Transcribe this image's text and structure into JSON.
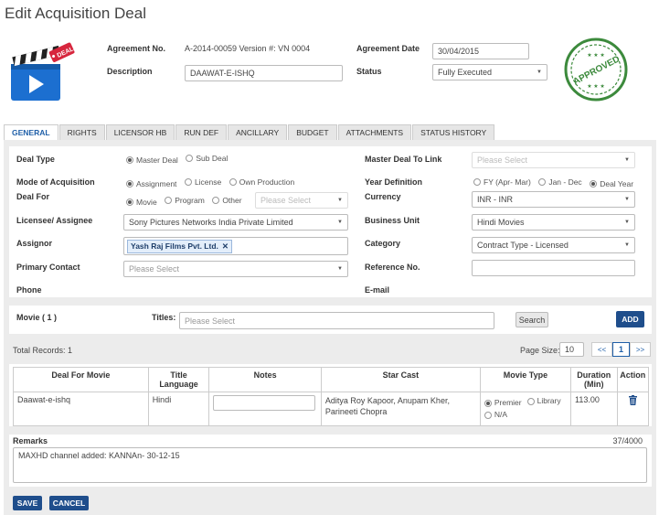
{
  "page_title": "Edit Acquisition Deal",
  "header": {
    "logo_badge": "DEAL",
    "stamp_text": "APPROVED",
    "agreement_no_label": "Agreement No.",
    "agreement_no_value": "A-2014-00059 Version #: VN 0004",
    "agreement_date_label": "Agreement Date",
    "agreement_date_value": "30/04/2015",
    "description_label": "Description",
    "description_value": "DAAWAT-E-ISHQ",
    "status_label": "Status",
    "status_value": "Fully Executed"
  },
  "tabs": [
    "GENERAL",
    "RIGHTS",
    "LICENSOR HB",
    "RUN DEF",
    "ANCILLARY",
    "BUDGET",
    "ATTACHMENTS",
    "STATUS HISTORY"
  ],
  "general": {
    "deal_type_label": "Deal Type",
    "deal_type_options": [
      "Master Deal",
      "Sub Deal"
    ],
    "master_deal_label": "Master Deal To Link",
    "master_deal_placeholder": "Please Select",
    "mode_label": "Mode of Acquisition",
    "mode_options": [
      "Assignment",
      "License",
      "Own Production"
    ],
    "year_def_label": "Year Definition",
    "year_def_options": [
      "FY (Apr- Mar)",
      "Jan - Dec",
      "Deal Year"
    ],
    "deal_for_label": "Deal For",
    "deal_for_options": [
      "Movie",
      "Program",
      "Other"
    ],
    "deal_for_other_placeholder": "Please Select",
    "currency_label": "Currency",
    "currency_value": "INR - INR",
    "licensee_label": "Licensee/ Assignee",
    "licensee_value": "Sony Pictures Networks India Private Limited",
    "business_unit_label": "Business Unit",
    "business_unit_value": "Hindi Movies",
    "assignor_label": "Assignor",
    "assignor_tag": "Yash Raj Films Pvt. Ltd.",
    "category_label": "Category",
    "category_value": "Contract Type - Licensed",
    "primary_contact_label": "Primary Contact",
    "primary_contact_placeholder": "Please Select",
    "reference_label": "Reference No.",
    "phone_label": "Phone",
    "email_label": "E-mail"
  },
  "movie_bar": {
    "movie_label": "Movie ( 1 )",
    "titles_label": "Titles:",
    "titles_placeholder": "Please Select",
    "search_label": "Search",
    "add_label": "ADD"
  },
  "records": {
    "total_label": "Total Records:",
    "total_value": "1",
    "page_size_label": "Page Size:",
    "page_size_value": "10",
    "prev": "<<",
    "current_page": "1",
    "next": ">>"
  },
  "table": {
    "headers": [
      "Deal For Movie",
      "Title Language",
      "Notes",
      "Star Cast",
      "Movie Type",
      "Duration (Min)",
      "Action"
    ],
    "rows": [
      {
        "movie": "Daawat-e-ishq",
        "language": "Hindi",
        "notes": "",
        "star_cast": "Aditya Roy Kapoor, Anupam Kher, Parineeti Chopra",
        "movie_type_options": [
          "Premier",
          "Library",
          "N/A"
        ],
        "duration": "113.00"
      }
    ]
  },
  "remarks": {
    "label": "Remarks",
    "counter": "37/4000",
    "value": "MAXHD channel added: KANNAn- 30-12-15"
  },
  "footer": {
    "save_label": "SAVE",
    "cancel_label": "CANCEL"
  },
  "colors": {
    "primary": "#1f4e8c",
    "tab_active_text": "#1f5fa8",
    "panel_bg": "#ececec",
    "stamp_green": "#3c8a3c"
  }
}
